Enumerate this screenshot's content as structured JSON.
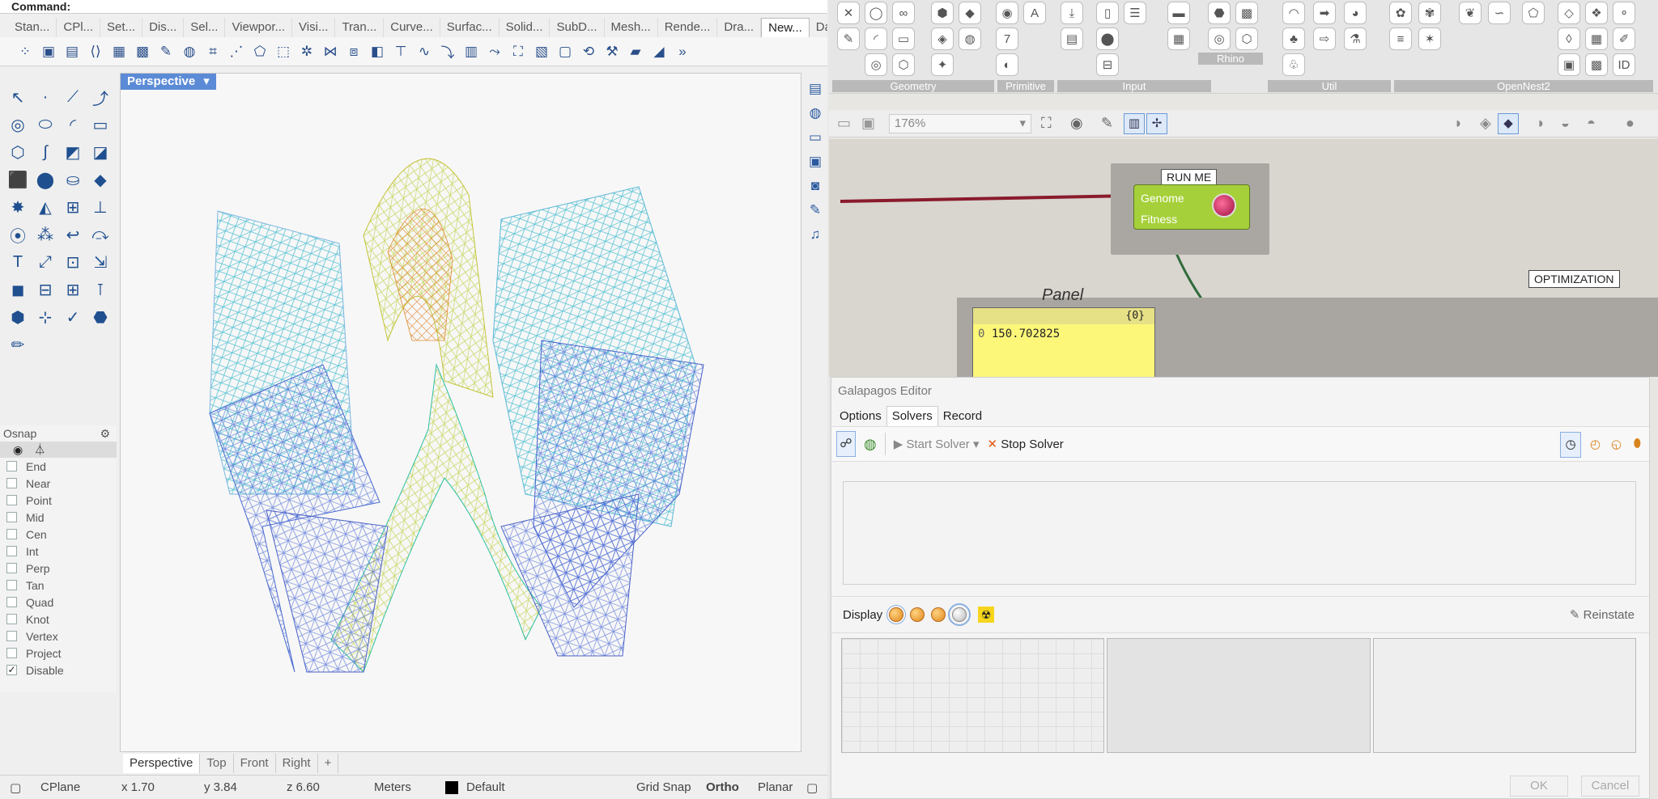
{
  "command": {
    "prompt": "Command:"
  },
  "rhino_tabs": [
    "Stan...",
    "CPl...",
    "Set...",
    "Dis...",
    "Sel...",
    "Viewpor...",
    "Visi...",
    "Tran...",
    "Curve...",
    "Surfac...",
    "Solid...",
    "SubD...",
    "Mesh...",
    "Rende...",
    "Dra...",
    "New...",
    "Data..."
  ],
  "active_tab_index": 15,
  "viewport": {
    "title": "Perspective",
    "dropdown": "▾"
  },
  "viewport_tabs": [
    "Perspective",
    "Top",
    "Front",
    "Right",
    "+"
  ],
  "osnap": {
    "title": "Osnap",
    "items": [
      {
        "label": "End",
        "checked": false
      },
      {
        "label": "Near",
        "checked": false
      },
      {
        "label": "Point",
        "checked": false
      },
      {
        "label": "Mid",
        "checked": false
      },
      {
        "label": "Cen",
        "checked": false
      },
      {
        "label": "Int",
        "checked": false
      },
      {
        "label": "Perp",
        "checked": false
      },
      {
        "label": "Tan",
        "checked": false
      },
      {
        "label": "Quad",
        "checked": false
      },
      {
        "label": "Knot",
        "checked": false
      },
      {
        "label": "Vertex",
        "checked": false
      },
      {
        "label": "Project",
        "checked": false
      },
      {
        "label": "Disable",
        "checked": true
      }
    ]
  },
  "status": {
    "cplane": "CPlane",
    "x": "x 1.70",
    "y": "y 3.84",
    "z": "z 6.60",
    "units": "Meters",
    "layer": "Default",
    "grid_snap": "Grid Snap",
    "ortho": "Ortho",
    "planar": "Planar"
  },
  "gh_ribbon_groups": [
    "Geometry",
    "Primitive",
    "Input",
    "Rhino",
    "Util",
    "OpenNest2"
  ],
  "gh_zoom": "176%",
  "canvas": {
    "runme_label": "RUN ME",
    "genome": "Genome",
    "fitness": "Fitness",
    "panel_title": "Panel",
    "panel_path": "{0}",
    "panel_index": "0",
    "panel_value": "150.702825",
    "optimization_label": "OPTIMIZATION"
  },
  "galapagos": {
    "title": "Galapagos Editor",
    "tabs": [
      "Options",
      "Solvers",
      "Record"
    ],
    "active_tab": 1,
    "start_solver": "Start Solver",
    "stop_solver": "Stop Solver",
    "display_label": "Display",
    "reinstate": "Reinstate",
    "ok": "OK",
    "cancel": "Cancel"
  }
}
